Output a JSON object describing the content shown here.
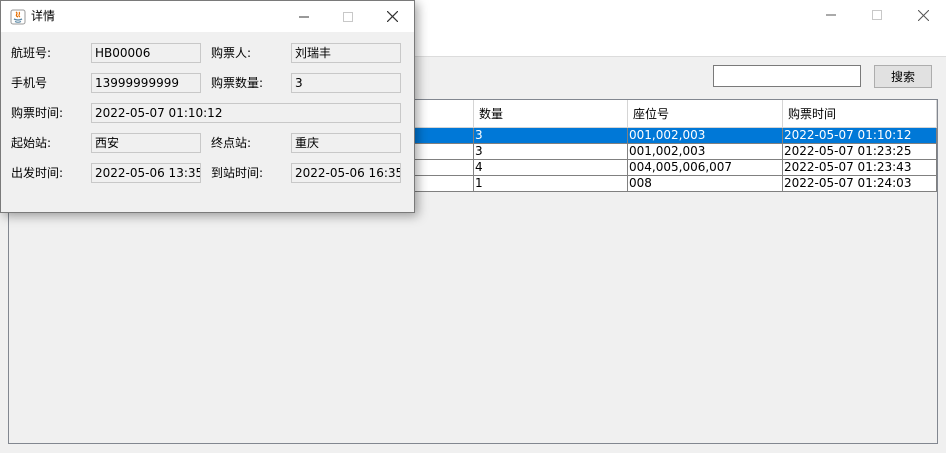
{
  "main": {
    "search": {
      "value": "",
      "button_label": "搜索"
    },
    "table": {
      "columns": [
        {
          "label": ""
        },
        {
          "label": "数量"
        },
        {
          "label": "座位号"
        },
        {
          "label": "购票时间"
        }
      ],
      "rows": [
        {
          "quantity": "3",
          "seats": "001,002,003",
          "time": "2022-05-07 01:10:12",
          "selected": true
        },
        {
          "quantity": "3",
          "seats": "001,002,003",
          "time": "2022-05-07 01:23:25",
          "selected": false
        },
        {
          "quantity": "4",
          "seats": "004,005,006,007",
          "time": "2022-05-07 01:23:43",
          "selected": false
        },
        {
          "quantity": "1",
          "seats": "008",
          "time": "2022-05-07 01:24:03",
          "selected": false
        }
      ]
    }
  },
  "dialog": {
    "title": "详情",
    "fields": {
      "flight_no": {
        "label": "航班号:",
        "value": "HB00006"
      },
      "buyer": {
        "label": "购票人:",
        "value": "刘瑞丰"
      },
      "phone": {
        "label": "手机号",
        "value": "13999999999"
      },
      "ticket_count": {
        "label": "购票数量:",
        "value": "3"
      },
      "purchase_time": {
        "label": "购票时间:",
        "value": "2022-05-07 01:10:12"
      },
      "origin": {
        "label": "起始站:",
        "value": "西安"
      },
      "destination": {
        "label": "终点站:",
        "value": "重庆"
      },
      "departure_time": {
        "label": "出发时间:",
        "value": "2022-05-06 13:35"
      },
      "arrival_time": {
        "label": "到站时间:",
        "value": "2022-05-06 16:35"
      }
    }
  },
  "colors": {
    "selection": "#0078d7",
    "window_bg": "#f0f0f0"
  },
  "icons": [
    "java-app-icon",
    "minimize-icon",
    "maximize-icon",
    "close-icon"
  ]
}
